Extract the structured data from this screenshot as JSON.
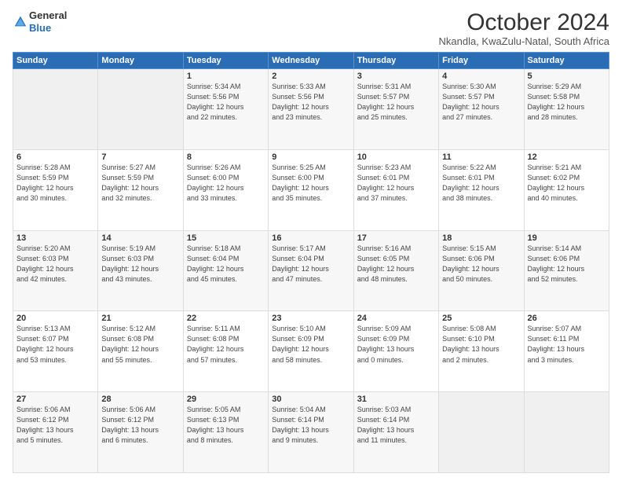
{
  "logo": {
    "general": "General",
    "blue": "Blue"
  },
  "title": "October 2024",
  "location": "Nkandla, KwaZulu-Natal, South Africa",
  "days_header": [
    "Sunday",
    "Monday",
    "Tuesday",
    "Wednesday",
    "Thursday",
    "Friday",
    "Saturday"
  ],
  "weeks": [
    [
      {
        "day": "",
        "detail": ""
      },
      {
        "day": "",
        "detail": ""
      },
      {
        "day": "1",
        "detail": "Sunrise: 5:34 AM\nSunset: 5:56 PM\nDaylight: 12 hours\nand 22 minutes."
      },
      {
        "day": "2",
        "detail": "Sunrise: 5:33 AM\nSunset: 5:56 PM\nDaylight: 12 hours\nand 23 minutes."
      },
      {
        "day": "3",
        "detail": "Sunrise: 5:31 AM\nSunset: 5:57 PM\nDaylight: 12 hours\nand 25 minutes."
      },
      {
        "day": "4",
        "detail": "Sunrise: 5:30 AM\nSunset: 5:57 PM\nDaylight: 12 hours\nand 27 minutes."
      },
      {
        "day": "5",
        "detail": "Sunrise: 5:29 AM\nSunset: 5:58 PM\nDaylight: 12 hours\nand 28 minutes."
      }
    ],
    [
      {
        "day": "6",
        "detail": "Sunrise: 5:28 AM\nSunset: 5:59 PM\nDaylight: 12 hours\nand 30 minutes."
      },
      {
        "day": "7",
        "detail": "Sunrise: 5:27 AM\nSunset: 5:59 PM\nDaylight: 12 hours\nand 32 minutes."
      },
      {
        "day": "8",
        "detail": "Sunrise: 5:26 AM\nSunset: 6:00 PM\nDaylight: 12 hours\nand 33 minutes."
      },
      {
        "day": "9",
        "detail": "Sunrise: 5:25 AM\nSunset: 6:00 PM\nDaylight: 12 hours\nand 35 minutes."
      },
      {
        "day": "10",
        "detail": "Sunrise: 5:23 AM\nSunset: 6:01 PM\nDaylight: 12 hours\nand 37 minutes."
      },
      {
        "day": "11",
        "detail": "Sunrise: 5:22 AM\nSunset: 6:01 PM\nDaylight: 12 hours\nand 38 minutes."
      },
      {
        "day": "12",
        "detail": "Sunrise: 5:21 AM\nSunset: 6:02 PM\nDaylight: 12 hours\nand 40 minutes."
      }
    ],
    [
      {
        "day": "13",
        "detail": "Sunrise: 5:20 AM\nSunset: 6:03 PM\nDaylight: 12 hours\nand 42 minutes."
      },
      {
        "day": "14",
        "detail": "Sunrise: 5:19 AM\nSunset: 6:03 PM\nDaylight: 12 hours\nand 43 minutes."
      },
      {
        "day": "15",
        "detail": "Sunrise: 5:18 AM\nSunset: 6:04 PM\nDaylight: 12 hours\nand 45 minutes."
      },
      {
        "day": "16",
        "detail": "Sunrise: 5:17 AM\nSunset: 6:04 PM\nDaylight: 12 hours\nand 47 minutes."
      },
      {
        "day": "17",
        "detail": "Sunrise: 5:16 AM\nSunset: 6:05 PM\nDaylight: 12 hours\nand 48 minutes."
      },
      {
        "day": "18",
        "detail": "Sunrise: 5:15 AM\nSunset: 6:06 PM\nDaylight: 12 hours\nand 50 minutes."
      },
      {
        "day": "19",
        "detail": "Sunrise: 5:14 AM\nSunset: 6:06 PM\nDaylight: 12 hours\nand 52 minutes."
      }
    ],
    [
      {
        "day": "20",
        "detail": "Sunrise: 5:13 AM\nSunset: 6:07 PM\nDaylight: 12 hours\nand 53 minutes."
      },
      {
        "day": "21",
        "detail": "Sunrise: 5:12 AM\nSunset: 6:08 PM\nDaylight: 12 hours\nand 55 minutes."
      },
      {
        "day": "22",
        "detail": "Sunrise: 5:11 AM\nSunset: 6:08 PM\nDaylight: 12 hours\nand 57 minutes."
      },
      {
        "day": "23",
        "detail": "Sunrise: 5:10 AM\nSunset: 6:09 PM\nDaylight: 12 hours\nand 58 minutes."
      },
      {
        "day": "24",
        "detail": "Sunrise: 5:09 AM\nSunset: 6:09 PM\nDaylight: 13 hours\nand 0 minutes."
      },
      {
        "day": "25",
        "detail": "Sunrise: 5:08 AM\nSunset: 6:10 PM\nDaylight: 13 hours\nand 2 minutes."
      },
      {
        "day": "26",
        "detail": "Sunrise: 5:07 AM\nSunset: 6:11 PM\nDaylight: 13 hours\nand 3 minutes."
      }
    ],
    [
      {
        "day": "27",
        "detail": "Sunrise: 5:06 AM\nSunset: 6:12 PM\nDaylight: 13 hours\nand 5 minutes."
      },
      {
        "day": "28",
        "detail": "Sunrise: 5:06 AM\nSunset: 6:12 PM\nDaylight: 13 hours\nand 6 minutes."
      },
      {
        "day": "29",
        "detail": "Sunrise: 5:05 AM\nSunset: 6:13 PM\nDaylight: 13 hours\nand 8 minutes."
      },
      {
        "day": "30",
        "detail": "Sunrise: 5:04 AM\nSunset: 6:14 PM\nDaylight: 13 hours\nand 9 minutes."
      },
      {
        "day": "31",
        "detail": "Sunrise: 5:03 AM\nSunset: 6:14 PM\nDaylight: 13 hours\nand 11 minutes."
      },
      {
        "day": "",
        "detail": ""
      },
      {
        "day": "",
        "detail": ""
      }
    ]
  ]
}
